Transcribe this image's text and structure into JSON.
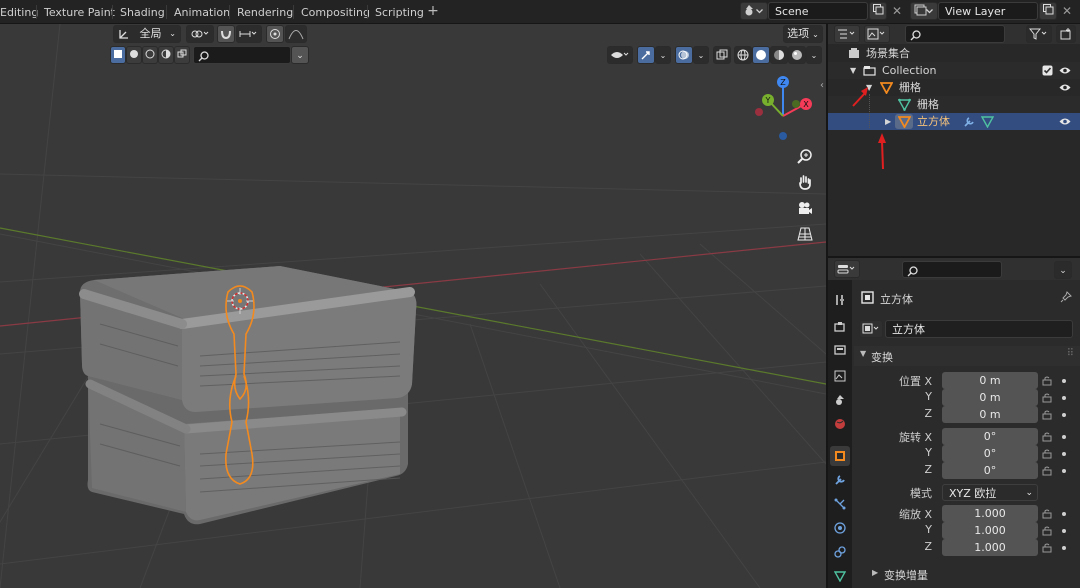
{
  "workspaces": {
    "tabs": [
      {
        "label": "Editing"
      },
      {
        "label": "Texture Paint"
      },
      {
        "label": "Shading"
      },
      {
        "label": "Animation"
      },
      {
        "label": "Rendering"
      },
      {
        "label": "Compositing"
      },
      {
        "label": "Scripting"
      }
    ],
    "add": "+"
  },
  "scene": {
    "name": "Scene",
    "icon": "scene-icon"
  },
  "view_layer": {
    "name": "View Layer",
    "icon": "render-layers-icon"
  },
  "viewport_header": {
    "transform_orientation": "全局",
    "options_label": "选项",
    "search_placeholder": ""
  },
  "outliner": {
    "search_placeholder": "",
    "rows": [
      {
        "label": "场景集合",
        "icon": "scene-collection-icon"
      },
      {
        "label": "Collection",
        "icon": "collection-icon"
      },
      {
        "label": "栅格",
        "icon": "mesh-object-icon"
      },
      {
        "label": "栅格",
        "icon": "mesh-data-icon"
      },
      {
        "label": "立方体",
        "icon": "mesh-object-icon",
        "selected": true
      }
    ]
  },
  "properties": {
    "search_placeholder": "",
    "object_name": "立方体",
    "object_name_field": "立方体",
    "transform_panel": "变换",
    "location": {
      "label": "位置 X",
      "x": "0 m",
      "y": "0 m",
      "z": "0 m"
    },
    "rotation": {
      "label": "旋转 X",
      "x": "0°",
      "y": "0°",
      "z": "0°"
    },
    "rotation_mode_label": "模式",
    "rotation_mode": "XYZ 欧拉",
    "scale": {
      "label": "缩放 X",
      "x": "1.000",
      "y": "1.000",
      "z": "1.000"
    },
    "axis_y": "Y",
    "axis_z": "Z",
    "delta_panel": "变换增量"
  },
  "gizmo": {
    "x": "X",
    "y": "Y",
    "z": "Z"
  },
  "colors": {
    "accent": "#4772b3",
    "selected_row": "#334d80",
    "object_orange": "#f28a1f",
    "x_axis": "#f53b57",
    "y_axis": "#78b02e",
    "z_axis": "#3f88f2"
  }
}
